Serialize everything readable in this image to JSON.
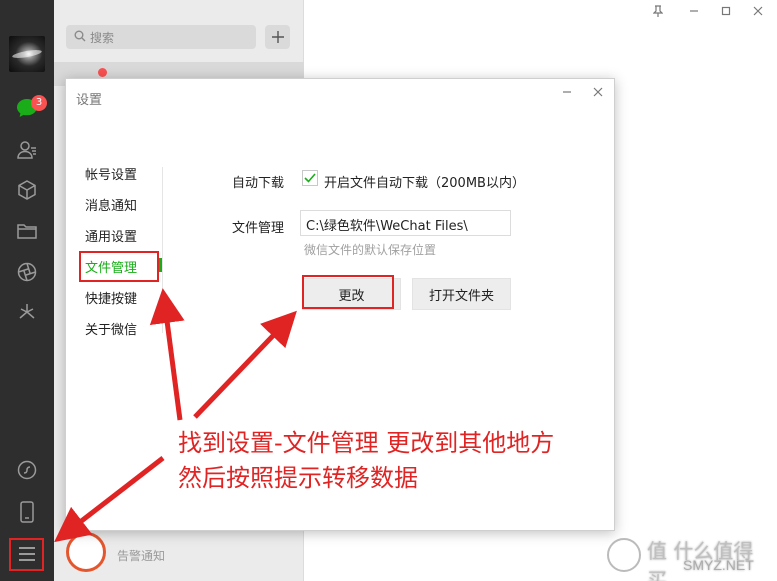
{
  "app": {
    "badge_count": "3",
    "search_placeholder": "搜索",
    "bottom_chat_name": "告警通知"
  },
  "dialog": {
    "title": "设置",
    "nav": [
      "帐号设置",
      "消息通知",
      "通用设置",
      "文件管理",
      "快捷按键",
      "关于微信"
    ],
    "active_index": 3,
    "auto_download_label": "自动下载",
    "auto_download_option": "开启文件自动下载（200MB以内）",
    "auto_download_checked": true,
    "file_manage_label": "文件管理",
    "file_path": "C:\\绿色软件\\WeChat Files\\",
    "path_hint": "微信文件的默认保存位置",
    "change_button": "更改",
    "open_folder_button": "打开文件夹"
  },
  "annotation": {
    "line1": "找到设置-文件管理 更改到其他地方",
    "line2": "然后按照提示转移数据"
  },
  "watermark": {
    "cn": "值 什么值得买",
    "en": "SMYZ.NET"
  },
  "colors": {
    "sidebar": "#2e2e2e",
    "wechat_green": "#1aad19",
    "annotation_red": "#e02424",
    "badge_red": "#fa5151"
  }
}
